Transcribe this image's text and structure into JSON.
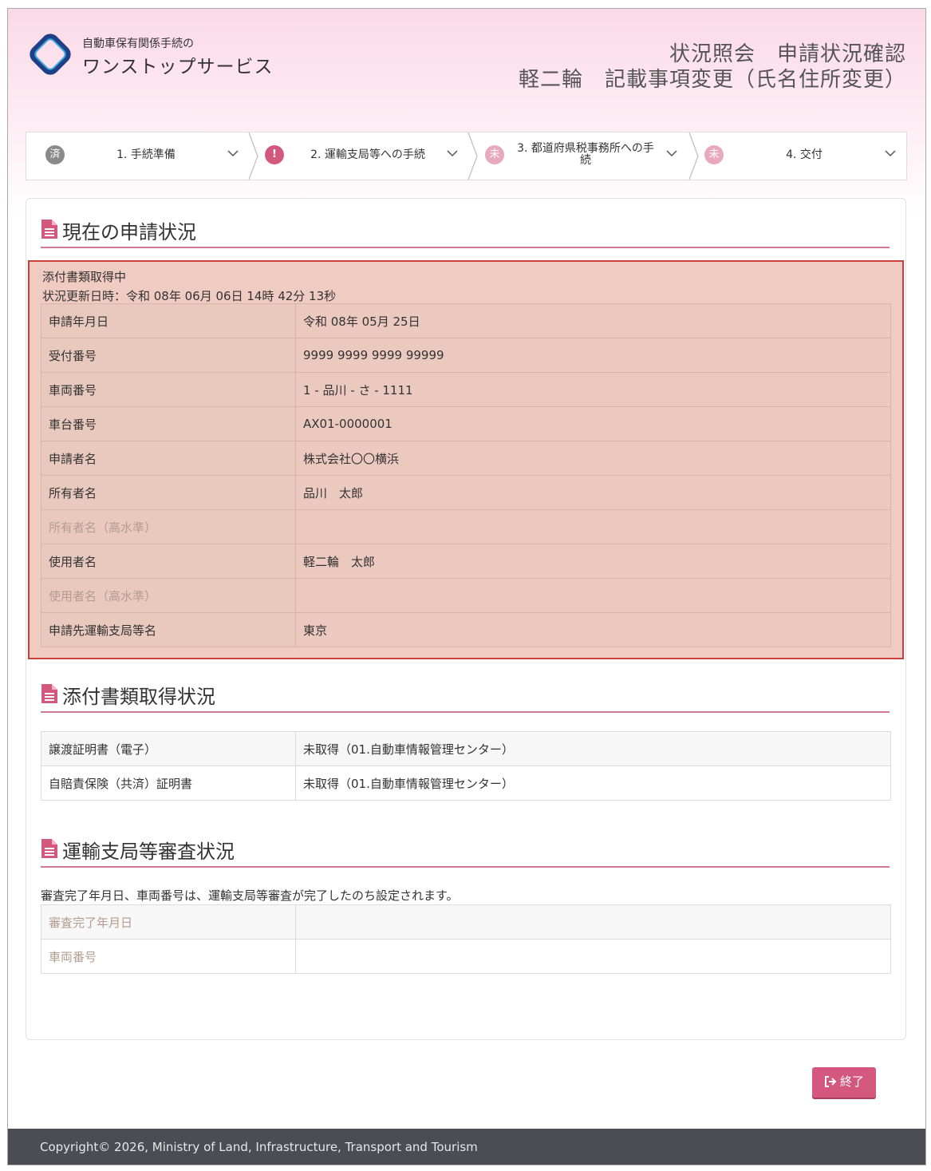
{
  "header": {
    "logo_line1": "自動車保有関係手続の",
    "logo_line2": "ワンストップサービス",
    "title_line1": "状況照会　申請状況確認",
    "title_line2": "軽二輪　記載事項変更（氏名住所変更）"
  },
  "steps": [
    {
      "badge": "済",
      "label": "1. 手続準備",
      "color": "#8a8a8a"
    },
    {
      "badge": "!",
      "label": "2. 運輸支局等への手続",
      "color": "#d4587d"
    },
    {
      "badge": "未",
      "label": "3. 都道府県税事務所への手続",
      "color": "#e8a9bc"
    },
    {
      "badge": "未",
      "label": "4. 交付",
      "color": "#e8a9bc"
    }
  ],
  "current": {
    "heading": "現在の申請状況",
    "status": "添付書類取得中",
    "updated": "状況更新日時：令和 08年 06月 06日 14時 42分 13秒",
    "rows": [
      {
        "key": "申請年月日",
        "value": "令和 08年 05月 25日"
      },
      {
        "key": "受付番号",
        "value": "9999 9999 9999 99999"
      },
      {
        "key": "車両番号",
        "value": "1 - 品川 - さ - 1111"
      },
      {
        "key": "車台番号",
        "value": "AX01-0000001"
      },
      {
        "key": "申請者名",
        "value": "株式会社〇〇横浜"
      },
      {
        "key": "所有者名",
        "value": "品川　太郎"
      },
      {
        "key": "所有者名（高水準）",
        "value": ""
      },
      {
        "key": "使用者名",
        "value": "軽二輪　太郎"
      },
      {
        "key": "使用者名（高水準）",
        "value": ""
      },
      {
        "key": "申請先運輸支局等名",
        "value": "東京"
      }
    ]
  },
  "attachments": {
    "heading": "添付書類取得状況",
    "rows": [
      {
        "key": "譲渡証明書（電子）",
        "value": "未取得（01.自動車情報管理センター）"
      },
      {
        "key": "自賠責保険（共済）証明書",
        "value": "未取得（01.自動車情報管理センター）"
      }
    ]
  },
  "review": {
    "heading": "運輸支局等審査状況",
    "note": "審査完了年月日、車両番号は、運輸支局等審査が完了したのち設定されます。",
    "rows": [
      {
        "key": "審査完了年月日",
        "value": ""
      },
      {
        "key": "車両番号",
        "value": ""
      }
    ]
  },
  "end_button": "終了",
  "footer": "Copyright© 2026, Ministry of Land, Infrastructure, Transport and Tourism",
  "colors": {
    "accent": "#d4587d",
    "highlight_border": "#c9413a",
    "highlight_bg": "#f0cbc1",
    "footer_bg": "#4a4d54"
  }
}
